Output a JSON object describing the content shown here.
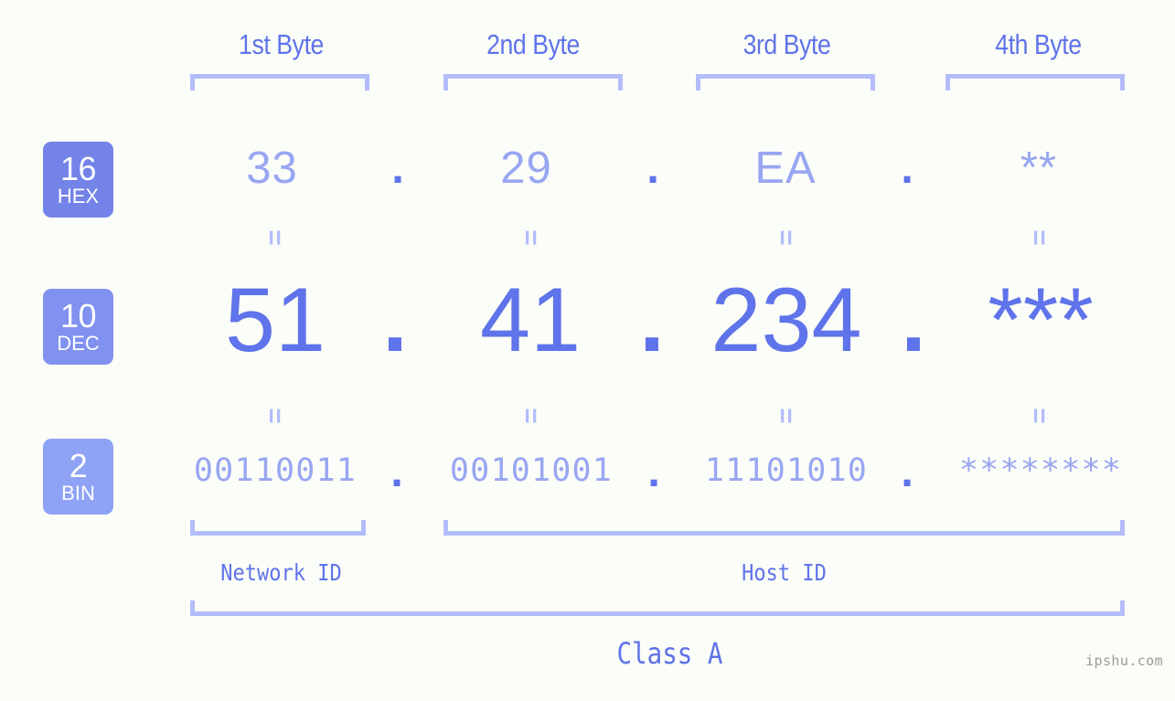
{
  "meta": {
    "background_color": "#fbfdf8",
    "accent_strong": "#5f73ea",
    "accent_mid": "#98a6f2",
    "accent_light": "#b3bdfb"
  },
  "byte_headers": [
    {
      "label": "1st Byte"
    },
    {
      "label": "2nd Byte"
    },
    {
      "label": "3rd Byte"
    },
    {
      "label": "4th Byte"
    }
  ],
  "bases": [
    {
      "number": "16",
      "name": "HEX",
      "color": "#7383e8"
    },
    {
      "number": "10",
      "name": "DEC",
      "color": "#8091ef"
    },
    {
      "number": "2",
      "name": "BIN",
      "color": "#8ea3f5"
    }
  ],
  "rows": {
    "hex": {
      "values": [
        "33",
        "29",
        "EA",
        "**"
      ],
      "separator": "."
    },
    "dec": {
      "values": [
        "51",
        "41",
        "234",
        "***"
      ],
      "separator": "."
    },
    "bin": {
      "values": [
        "00110011",
        "00101001",
        "11101010",
        "********"
      ],
      "separator": "."
    }
  },
  "equals_symbol": "=",
  "segments": {
    "network_id": "Network ID",
    "host_id": "Host ID"
  },
  "class_label": "Class A",
  "watermark": "ipshu.com"
}
